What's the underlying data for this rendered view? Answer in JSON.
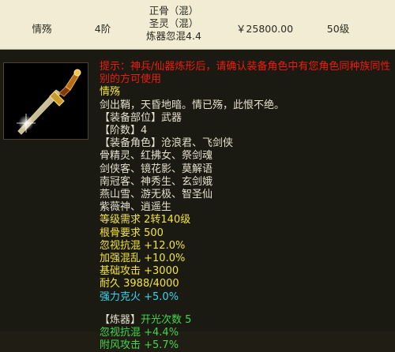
{
  "item_row": {
    "name": "情殇",
    "tier": "4阶",
    "attr_line1": "正骨（混）",
    "attr_line2": "圣灵（混）",
    "attr_line3": "炼器忽混4.4",
    "price": "￥25800.00",
    "grade": "50级"
  },
  "tooltip": {
    "warning": "提示：神兵/仙器炼形后，请确认装备角色中有您角色同种族同性别的方可使用",
    "item_name": "情殇",
    "description": "剑出鞘，天昏地暗。情已殇，此恨不绝。",
    "slot_label": "【装备部位】",
    "slot_value": "武器",
    "tier_label": "【阶数】",
    "tier_value": "4",
    "roles_label": "【装备角色】",
    "roles_lines": [
      "沧浪君、飞剑侠",
      "骨精灵、红拂女、祭剑魂",
      "剑侠客、镜花影、莫解语",
      "南冠客、神秀生、玄剑娥",
      "燕山雪、游无极、智圣仙",
      "紫薇神、逍遥生"
    ],
    "level_req": "等级需求 2转140级",
    "bone_req": "根骨要求 500",
    "stat_lines": [
      "忽视抗混 +12.0%",
      "加强混乱 +10.0%",
      "基础攻击 +3000",
      "耐久 3988/4000"
    ],
    "restrain": "强力克火 +5.0%",
    "refine_label": "【炼器】",
    "refine_slots": "开光次数 5",
    "refine_lines": [
      "忽视抗混 +4.4%",
      "附风攻击 +5.7%"
    ]
  },
  "colors": {
    "header_bg": "#f1ecd3",
    "tooltip_bg": "#1a1a12",
    "warning": "#f01c0e",
    "highlight": "#f3e43a",
    "bonus": "#44d54b",
    "restrain": "#3cd3ef"
  }
}
